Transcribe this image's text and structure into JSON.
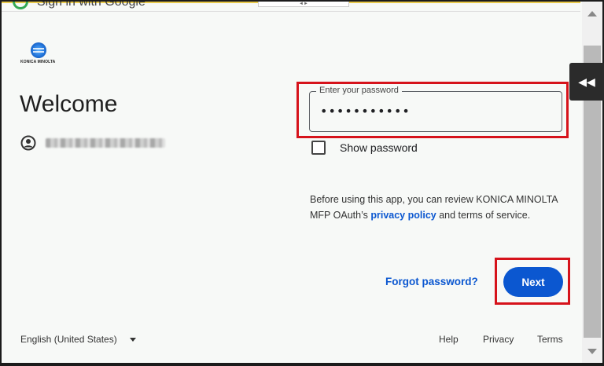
{
  "header": {
    "title": "Sign in with Google",
    "drag_glyph": "◄►"
  },
  "brand": {
    "name": "KONICA MINOLTA"
  },
  "page": {
    "heading": "Welcome"
  },
  "password": {
    "label": "Enter your password",
    "masked_value": "•••••••••••",
    "show_label": "Show password"
  },
  "notice": {
    "part1": "Before using this app, you can review KONICA MINOLTA MFP OAuth’s ",
    "link1": "privacy policy",
    "part2": " and terms of service."
  },
  "actions": {
    "forgot": "Forgot password?",
    "next": "Next"
  },
  "footer": {
    "language": "English (United States)",
    "help": "Help",
    "privacy": "Privacy",
    "terms": "Terms"
  },
  "side_tab": {
    "glyph": "◀◀"
  },
  "colors": {
    "accent": "#0b57d0",
    "highlight": "#d6131b",
    "background": "#f7f9f7"
  }
}
